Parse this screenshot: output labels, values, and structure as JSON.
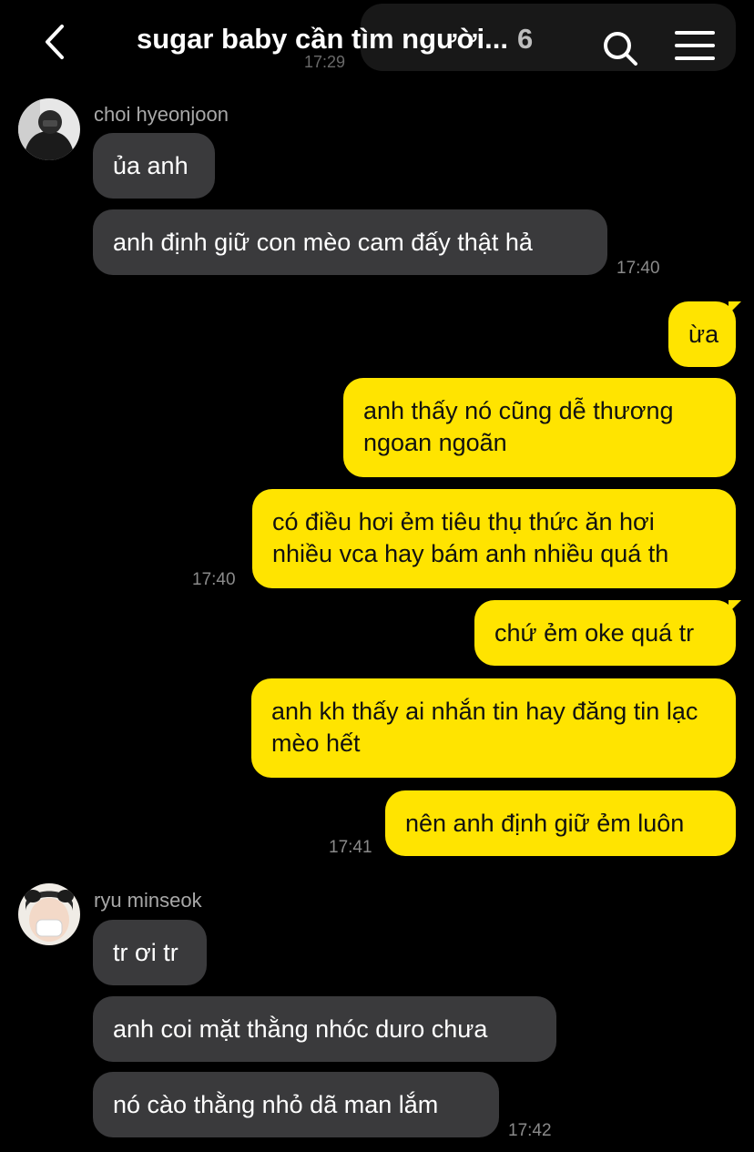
{
  "header": {
    "title": "sugar baby cần tìm người...",
    "member_count": "6"
  },
  "chat": {
    "sender1": {
      "name": "choi hyeonjoon"
    },
    "sender2": {
      "name": "ryu minseok"
    },
    "messages": [
      {
        "text": "ủa anh"
      },
      {
        "text": "anh định giữ con mèo cam đấy thật hả"
      },
      {
        "text": "ừa"
      },
      {
        "text": "anh thấy nó cũng dễ thương ngoan ngoãn"
      },
      {
        "text": "có điều hơi ẻm tiêu thụ thức ăn hơi nhiều vca hay bám anh nhiều quá th"
      },
      {
        "text": "chứ ẻm oke quá tr"
      },
      {
        "text": "anh kh thấy ai nhắn tin hay đăng tin lạc mèo hết"
      },
      {
        "text": "nên anh định giữ ẻm luôn"
      },
      {
        "text": "tr ơi tr"
      },
      {
        "text": "anh coi mặt thằng nhóc duro chưa"
      },
      {
        "text": "nó cào thằng nhỏ dã man lắm"
      }
    ],
    "timestamps": [
      "17:40",
      "17:40",
      "17:41",
      "17:42"
    ]
  },
  "colors": {
    "background": "#000000",
    "incoming_bubble": "#3a3a3c",
    "outgoing_bubble": "#ffe400"
  },
  "icons": {
    "back": "chevron-left-icon",
    "search": "search-icon",
    "menu": "hamburger-menu-icon"
  }
}
